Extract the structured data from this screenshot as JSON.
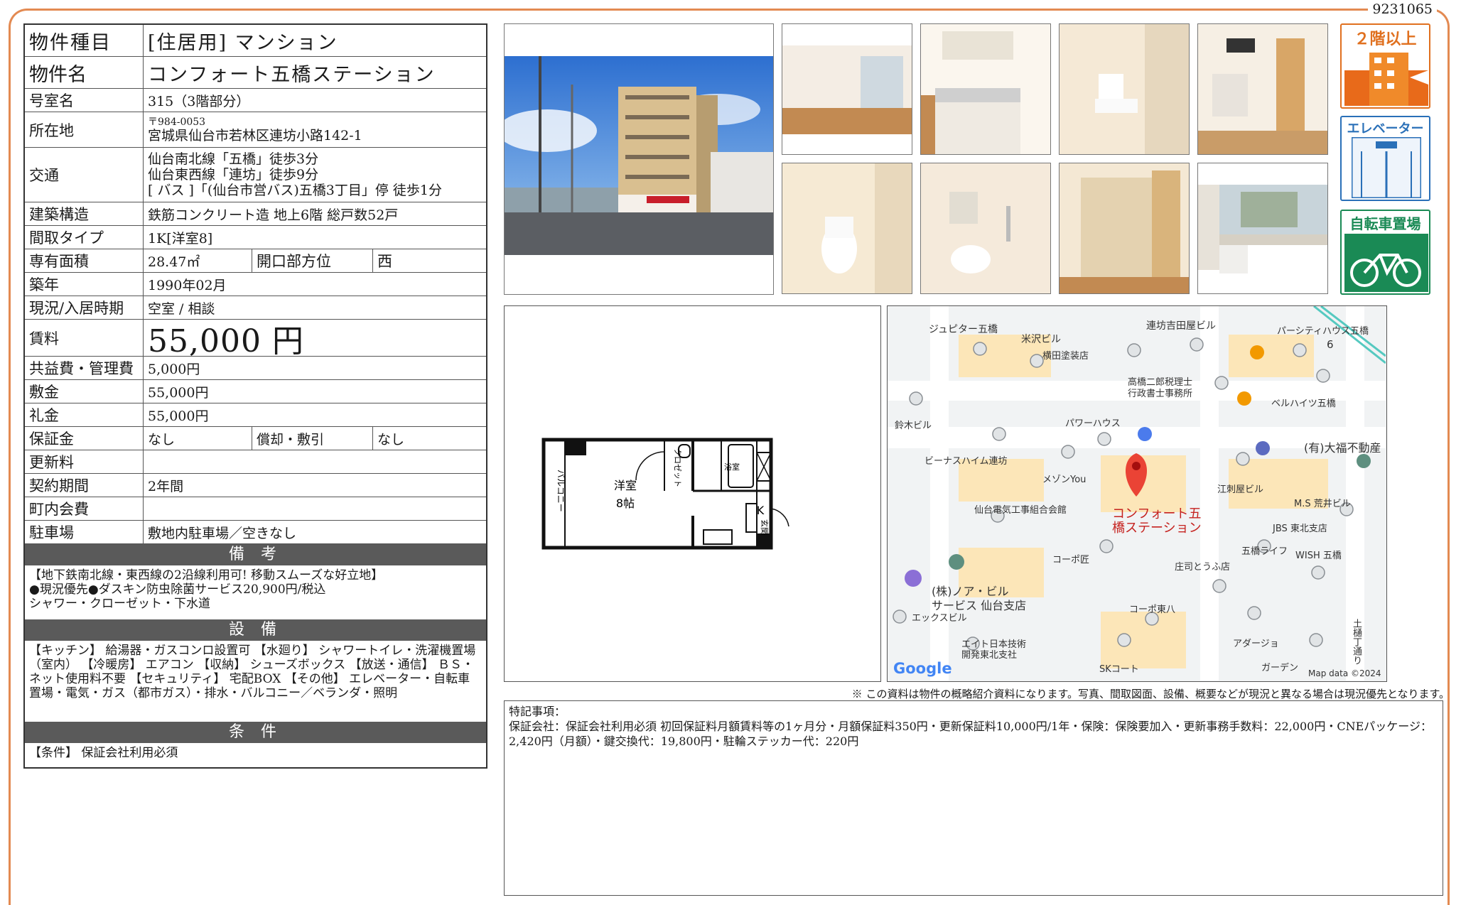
{
  "doc_no": "9231065",
  "rows": {
    "type": {
      "label": "物件種目",
      "value": "[住居用] マンション"
    },
    "name": {
      "label": "物件名",
      "value": "コンフォート五橋ステーション"
    },
    "room": {
      "label": "号室名",
      "value": "315（3階部分）"
    },
    "address": {
      "label": "所在地",
      "zip": "〒984-0053",
      "value": "宮城県仙台市若林区連坊小路142-1"
    },
    "access": {
      "label": "交通",
      "lines": [
        "仙台南北線「五橋」徒歩3分",
        "仙台東西線「連坊」徒歩9分",
        "[ バス ]「(仙台市営バス)五橋3丁目」停 徒歩1分"
      ]
    },
    "structure": {
      "label": "建築構造",
      "value": "鉄筋コンクリート造 地上6階 総戸数52戸"
    },
    "layout": {
      "label": "間取タイプ",
      "value": "1K[洋室8]"
    },
    "area": {
      "label": "専有面積",
      "value": "28.47㎡",
      "sub_label": "開口部方位",
      "sub_value": "西"
    },
    "built": {
      "label": "築年",
      "value": "1990年02月"
    },
    "status": {
      "label": "現況/入居時期",
      "value": "空室 / 相談"
    },
    "rent": {
      "label": "賃料",
      "value": "55,000 円"
    },
    "fee": {
      "label": "共益費・管理費",
      "value": "5,000円"
    },
    "deposit": {
      "label": "敷金",
      "value": "55,000円"
    },
    "key_money": {
      "label": "礼金",
      "value": "55,000円"
    },
    "guarantee": {
      "label": "保証金",
      "value": "なし",
      "sub_label": "償却・敷引",
      "sub_value": "なし"
    },
    "renewal": {
      "label": "更新料",
      "value": ""
    },
    "term": {
      "label": "契約期間",
      "value": "2年間"
    },
    "association": {
      "label": "町内会費",
      "value": ""
    },
    "parking": {
      "label": "駐車場",
      "value": "敷地内駐車場／空きなし"
    }
  },
  "remarks": {
    "title": "備 考",
    "text": "【地下鉄南北線・東西線の2沿線利用可! 移動スムーズな好立地】\n●現況優先●ダスキン防虫除菌サービス20,900円/税込\nシャワー・クローゼット・下水道"
  },
  "equipment": {
    "title": "設 備",
    "text": "【キッチン】 給湯器・ガスコンロ設置可 【水廻り】 シャワートイレ・洗濯機置場（室内） 【冷暖房】 エアコン 【収納】 シューズボックス 【放送・通信】 ＢＳ・ネット使用料不要 【セキュリティ】 宅配BOX 【その他】 エレベーター・自転車置場・電気・ガス（都市ガス）・排水・バルコニー／ベランダ・照明"
  },
  "conditions": {
    "title": "条 件",
    "text": "【条件】 保証会社利用必須"
  },
  "badges": {
    "floor": "２階以上",
    "elevator": "エレベーター",
    "bicycle": "自転車置場"
  },
  "floorplan": {
    "room_label": "洋室",
    "room_size": "8帖",
    "kitchen": "K",
    "closet": "クロゼット",
    "bath": "浴室",
    "entrance": "玄関",
    "balcony": "バルコニー"
  },
  "map": {
    "labels": [
      "ジュピター五橋",
      "米沢ビル",
      "連坊吉田屋ビル",
      "パーシティハウス五橋",
      "横田塗装店",
      "高橋二郎税理士",
      "行政書士事務所",
      "ベルハイツ五橋",
      "鈴木ビル",
      "パワーハウス",
      "(有)大福不動産",
      "ビーナスハイム連坊",
      "メゾンYou",
      "江刺屋ビル",
      "M.S 荒井ビル",
      "仙台電気工事組合会館",
      "コンフォート五",
      "橋ステーション",
      "JBS 東北支店",
      "五橋ライフ",
      "WISH 五橋",
      "コーポ匠",
      "庄司とうふ店",
      "(株)ノア・ビル",
      "サービス 仙台支店",
      "エックスビル",
      "コーポ東八",
      "エイト日本技術",
      "開発東北支社",
      "アダージョ",
      "SKコート",
      "ガーデン",
      "Map data ©2024",
      "Google",
      "6",
      "土樋丁通り"
    ]
  },
  "disclaimer": "※ この資料は物件の概略紹介資料になります。写真、間取図面、設備、概要などが現況と異なる場合は現況優先となります。",
  "special": {
    "title": "特記事項：",
    "text": "保証会社：保証会社利用必須 初回保証料月額賃料等の1ヶ月分・月額保証料350円・更新保証料10,000円/1年・保険：保険要加入・更新事務手数料：22,000円・CNEパッケージ：2,420円（月額）・鍵交換代：19,800円・駐輪ステッカー代：220円"
  }
}
